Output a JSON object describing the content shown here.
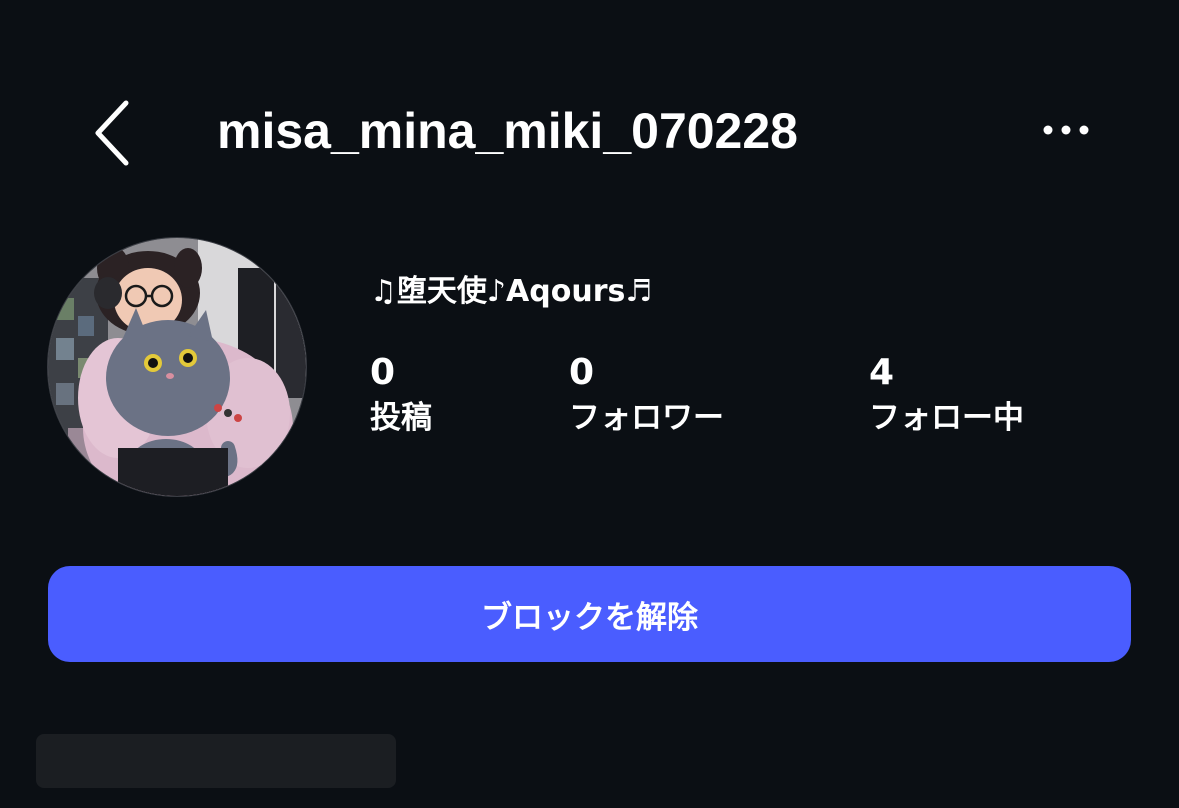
{
  "header": {
    "back_icon": "chevron-left-icon",
    "username": "misa_mina_miki_070228",
    "more_icon": "ellipsis-horizontal-icon"
  },
  "profile": {
    "avatar": "profile-photo",
    "bio": "♫堕天使♪Aqours♬",
    "stats": {
      "posts": {
        "count": "0",
        "label": "投稿"
      },
      "followers": {
        "count": "0",
        "label": "フォロワー"
      },
      "following": {
        "count": "4",
        "label": "フォロー中"
      }
    }
  },
  "actions": {
    "unblock_label": "ブロックを解除",
    "unblock_color": "#4a5dff"
  },
  "colors": {
    "background": "#0b0f14",
    "text": "#ffffff",
    "placeholder": "#1b1e22"
  }
}
